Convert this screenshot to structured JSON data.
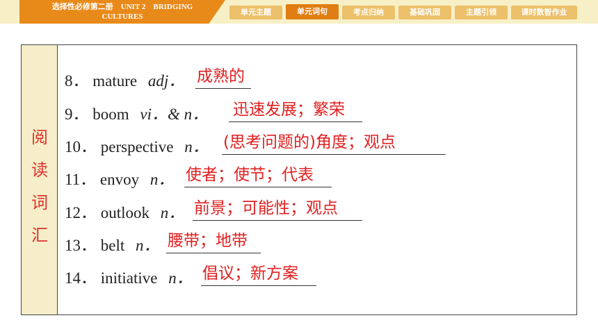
{
  "header": {
    "title_line1": "选择性必修第二册　UNIT 2　BRIDGING",
    "title_line2": "CULTURES",
    "tabs": [
      "单元主题",
      "单元词句",
      "考点归纳",
      "基础巩固",
      "主题引领",
      "课时数智作业"
    ],
    "active_tab": "单元词句",
    "colors": {
      "accent": "#e88a1a",
      "tab": "#ecc06a",
      "band": "#f7f0c6"
    }
  },
  "sidebar": {
    "chars": [
      "阅",
      "读",
      "词",
      "汇"
    ],
    "color": "#e03030"
  },
  "items": [
    {
      "num": "8．",
      "word": "mature",
      "pos": "adj．",
      "answer": "成熟的"
    },
    {
      "num": "9．",
      "word": "boom",
      "pos": "vi．& n．",
      "answer": "迅速发展；繁荣"
    },
    {
      "num": "10．",
      "word": "perspective",
      "pos": "n．",
      "answer": "(思考问题的)角度；观点"
    },
    {
      "num": "11．",
      "word": "envoy",
      "pos": "n．",
      "answer": "使者；使节；代表"
    },
    {
      "num": "12．",
      "word": "outlook",
      "pos": "n．",
      "answer": "前景；可能性；观点"
    },
    {
      "num": "13．",
      "word": "belt",
      "pos": "n．",
      "answer": "腰带；地带"
    },
    {
      "num": "14．",
      "word": "initiative",
      "pos": "n．",
      "answer": "倡议；新方案"
    }
  ]
}
